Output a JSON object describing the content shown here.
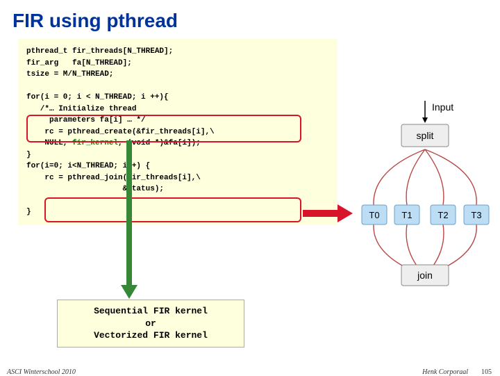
{
  "title": "FIR using pthread",
  "code": {
    "l1": "pthread_t fir_threads[N_THREAD];",
    "l2": "fir_arg   fa[N_THREAD];",
    "l3": "tsize = M/N_THREAD;",
    "l4": "",
    "l5": "for(i = 0; i < N_THREAD; i ++){",
    "l6": "   /*… Initialize thread",
    "l7": "     parameters fa[i] … */",
    "l8": "    rc = pthread_create(&fir_threads[i],\\",
    "l9a": "    NULL, ",
    "l9b": "fir_kernel",
    "l9c": ", (void *)&fa[i]);",
    "l10": "}",
    "l11": "for(i=0; i<N_THREAD; i++) {",
    "l12": "    rc = pthread_join(fir_threads[i],\\",
    "l13": "                     &status);",
    "l14": "",
    "l15": "}"
  },
  "kernel_box": {
    "l1": "Sequential FIR kernel",
    "l2": "or",
    "l3": "Vectorized FIR kernel"
  },
  "diagram": {
    "input": "Input",
    "split": "split",
    "threads": [
      "T0",
      "T1",
      "T2",
      "T3"
    ],
    "join": "join"
  },
  "footer": {
    "left": "ASCI Winterschool 2010",
    "right": "Henk Corporaal",
    "num": "105"
  }
}
